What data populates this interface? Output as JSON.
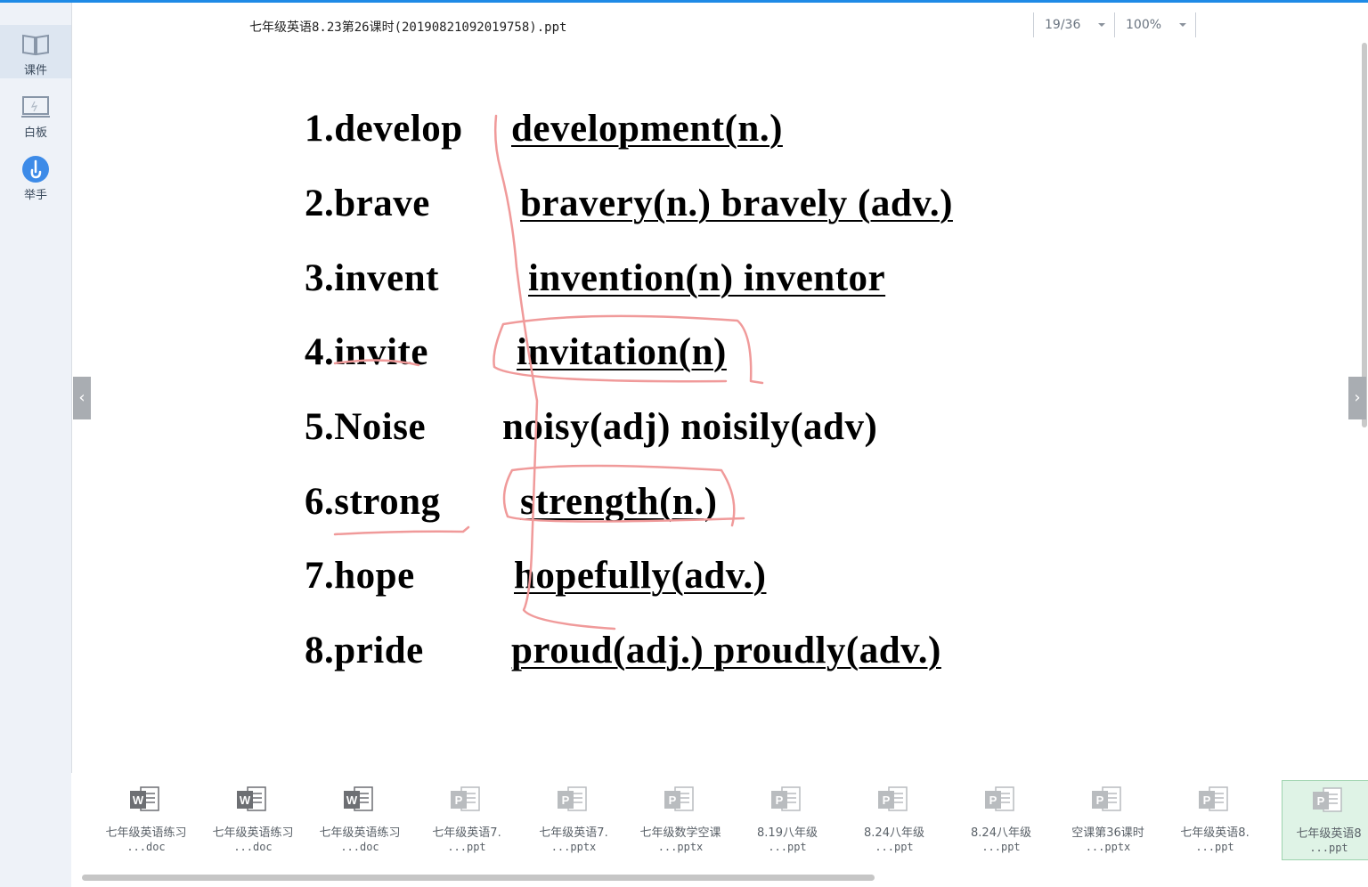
{
  "title": "七年级英语8.23第26课时(20190821092019758).ppt",
  "page_indicator": "19/36",
  "zoom": "100%",
  "sidebar": [
    {
      "label": "课件",
      "icon": "book-icon"
    },
    {
      "label": "白板",
      "icon": "whiteboard-icon"
    },
    {
      "label": "举手",
      "icon": "raise-hand-icon"
    }
  ],
  "slide": {
    "rows": [
      {
        "word": "1.develop",
        "forms": "development(n.)"
      },
      {
        "word": "2.brave",
        "forms": "bravery(n.) bravely (adv.)"
      },
      {
        "word": "3.invent",
        "forms": "invention(n) inventor"
      },
      {
        "word": "4.invite",
        "forms": "invitation(n)"
      },
      {
        "word": "5.Noise",
        "forms": "noisy(adj) noisily(adv)"
      },
      {
        "word": "6.strong",
        "forms": "strength(n.)"
      },
      {
        "word": "7.hope",
        "forms": "hopefully(adv.)"
      },
      {
        "word": "8.pride",
        "forms": "proud(adj.) proudly(adv.)"
      }
    ]
  },
  "files": [
    {
      "name": "七年级英语练习",
      "ext": "...doc",
      "type": "word"
    },
    {
      "name": "七年级英语练习",
      "ext": "...doc",
      "type": "word"
    },
    {
      "name": "七年级英语练习",
      "ext": "...doc",
      "type": "word"
    },
    {
      "name": "七年级英语7.",
      "ext": "...ppt",
      "type": "ppt"
    },
    {
      "name": "七年级英语7.",
      "ext": "...pptx",
      "type": "ppt"
    },
    {
      "name": "七年级数学空课",
      "ext": "...pptx",
      "type": "ppt"
    },
    {
      "name": "8.19八年级",
      "ext": "...ppt",
      "type": "ppt"
    },
    {
      "name": "8.24八年级",
      "ext": "...ppt",
      "type": "ppt"
    },
    {
      "name": "8.24八年级",
      "ext": "...ppt",
      "type": "ppt"
    },
    {
      "name": "空课第36课时",
      "ext": "...pptx",
      "type": "ppt"
    },
    {
      "name": "七年级英语8.",
      "ext": "...ppt",
      "type": "ppt"
    },
    {
      "name": "七年级英语8",
      "ext": "...ppt",
      "type": "ppt"
    }
  ],
  "colors": {
    "accent": "#1e8ae6",
    "ink": "#f09a9a",
    "word_icon": "#6d6f73",
    "ppt_icon": "#b9bcbf",
    "selected": "#dff3e6"
  }
}
